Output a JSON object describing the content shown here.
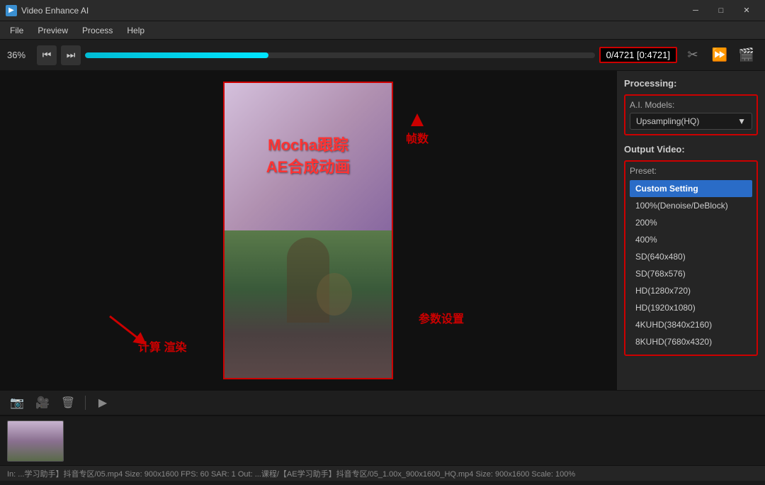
{
  "titlebar": {
    "title": "Video Enhance AI",
    "min_label": "─",
    "max_label": "□",
    "close_label": "✕"
  },
  "menubar": {
    "items": [
      "File",
      "Preview",
      "Process",
      "Help"
    ]
  },
  "toolbar": {
    "zoom": "36%",
    "skip_back_label": "⏮",
    "step_back_label": "⏪",
    "frame_display": "0/4721  [0:4721]",
    "cut_icon": "✂",
    "forward_icon": "⏩",
    "export_icon": "🎬"
  },
  "annotations": {
    "frames_label": "帧数",
    "params_label": "参数设置",
    "calc_label": "计算 渲染"
  },
  "preview": {
    "overlay_line1": "Mocha跟踪",
    "overlay_line2": "AE合成动画"
  },
  "right_panel": {
    "processing_label": "Processing:",
    "ai_models_label": "A.I. Models:",
    "ai_model_value": "Upsampling(HQ)",
    "output_video_label": "Output Video:",
    "preset_label": "Preset:",
    "presets": [
      {
        "label": "Custom Setting",
        "selected": true
      },
      {
        "label": "100%(Denoise/DeBlock)",
        "selected": false
      },
      {
        "label": "200%",
        "selected": false
      },
      {
        "label": "400%",
        "selected": false
      },
      {
        "label": "SD(640x480)",
        "selected": false
      },
      {
        "label": "SD(768x576)",
        "selected": false
      },
      {
        "label": "HD(1280x720)",
        "selected": false
      },
      {
        "label": "HD(1920x1080)",
        "selected": false
      },
      {
        "label": "4KUHD(3840x2160)",
        "selected": false
      },
      {
        "label": "8KUHD(7680x4320)",
        "selected": false
      }
    ]
  },
  "bottom_toolbar": {
    "btn_camera_label": "📷",
    "btn_video_label": "🎥",
    "btn_delete_label": "🗑",
    "btn_play_label": "▶"
  },
  "statusbar": {
    "text": "In:  ...学习助手】抖音专区/05.mp4   Size: 900x1600   FPS: 60   SAR: 1     Out:  ...课程/【AE学习助手】抖音专区/05_1.00x_900x1600_HQ.mp4   Size: 900x1600   Scale: 100%"
  },
  "progress": {
    "percent": 36
  }
}
